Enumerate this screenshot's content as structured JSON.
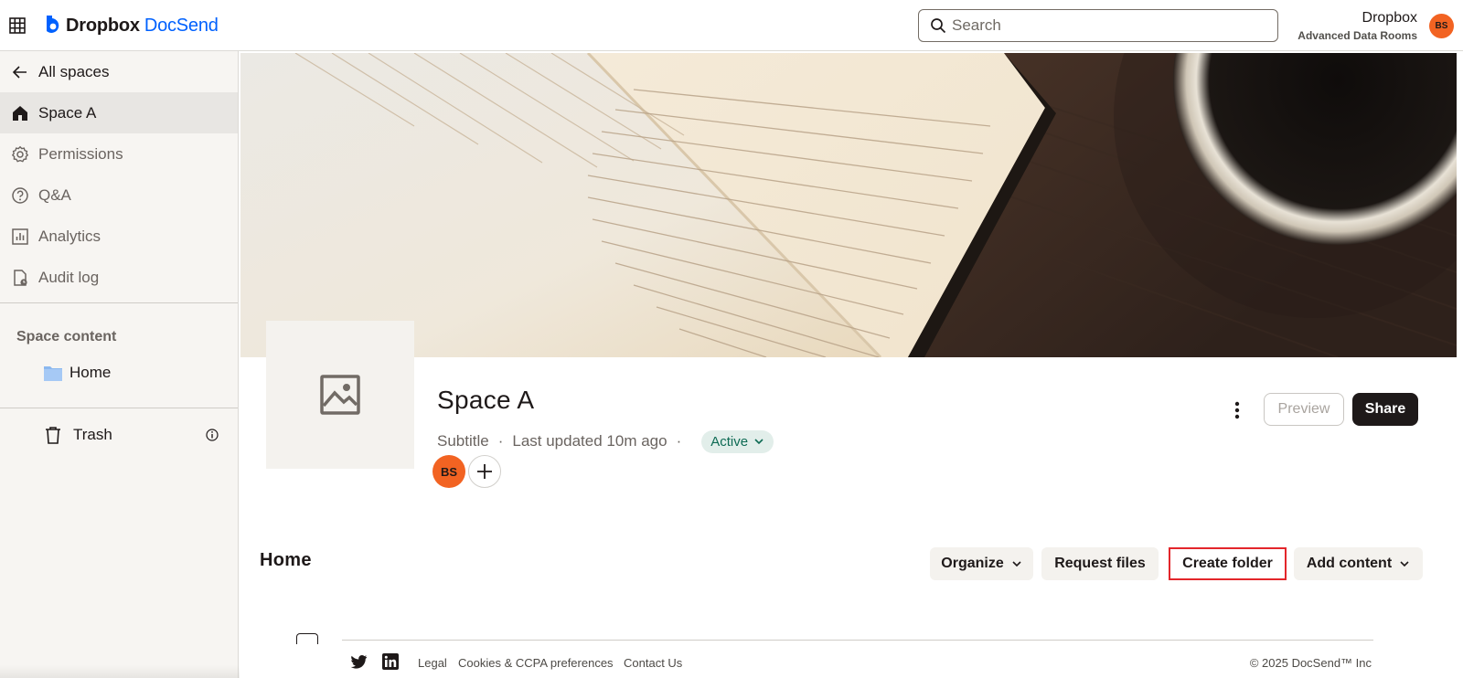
{
  "header": {
    "brand_primary": "Dropbox",
    "brand_secondary": "DocSend",
    "search_placeholder": "Search",
    "account_name": "Dropbox",
    "account_plan": "Advanced Data Rooms",
    "avatar_initials": "BS",
    "colors": {
      "brand_blue": "#0061fe",
      "avatar": "#f26322"
    }
  },
  "sidebar": {
    "back_label": "All spaces",
    "items": [
      {
        "label": "Space A",
        "icon": "home-icon",
        "active": true
      },
      {
        "label": "Permissions",
        "icon": "gear-icon"
      },
      {
        "label": "Q&A",
        "icon": "question-icon"
      },
      {
        "label": "Analytics",
        "icon": "chart-icon"
      },
      {
        "label": "Audit log",
        "icon": "audit-icon"
      }
    ],
    "section_heading": "Space content",
    "folder_label": "Home",
    "trash_label": "Trash"
  },
  "space": {
    "title": "Space A",
    "subtitle": "Subtitle",
    "updated": "Last updated 10m ago",
    "status": "Active",
    "member_initials": "BS",
    "preview_label": "Preview",
    "share_label": "Share"
  },
  "home": {
    "heading": "Home",
    "organize_label": "Organize",
    "request_label": "Request files",
    "create_folder_label": "Create folder",
    "add_content_label": "Add content"
  },
  "footer": {
    "links": [
      "Legal",
      "Cookies & CCPA preferences",
      "Contact Us"
    ],
    "copyright": "© 2025 DocSend™ Inc"
  }
}
